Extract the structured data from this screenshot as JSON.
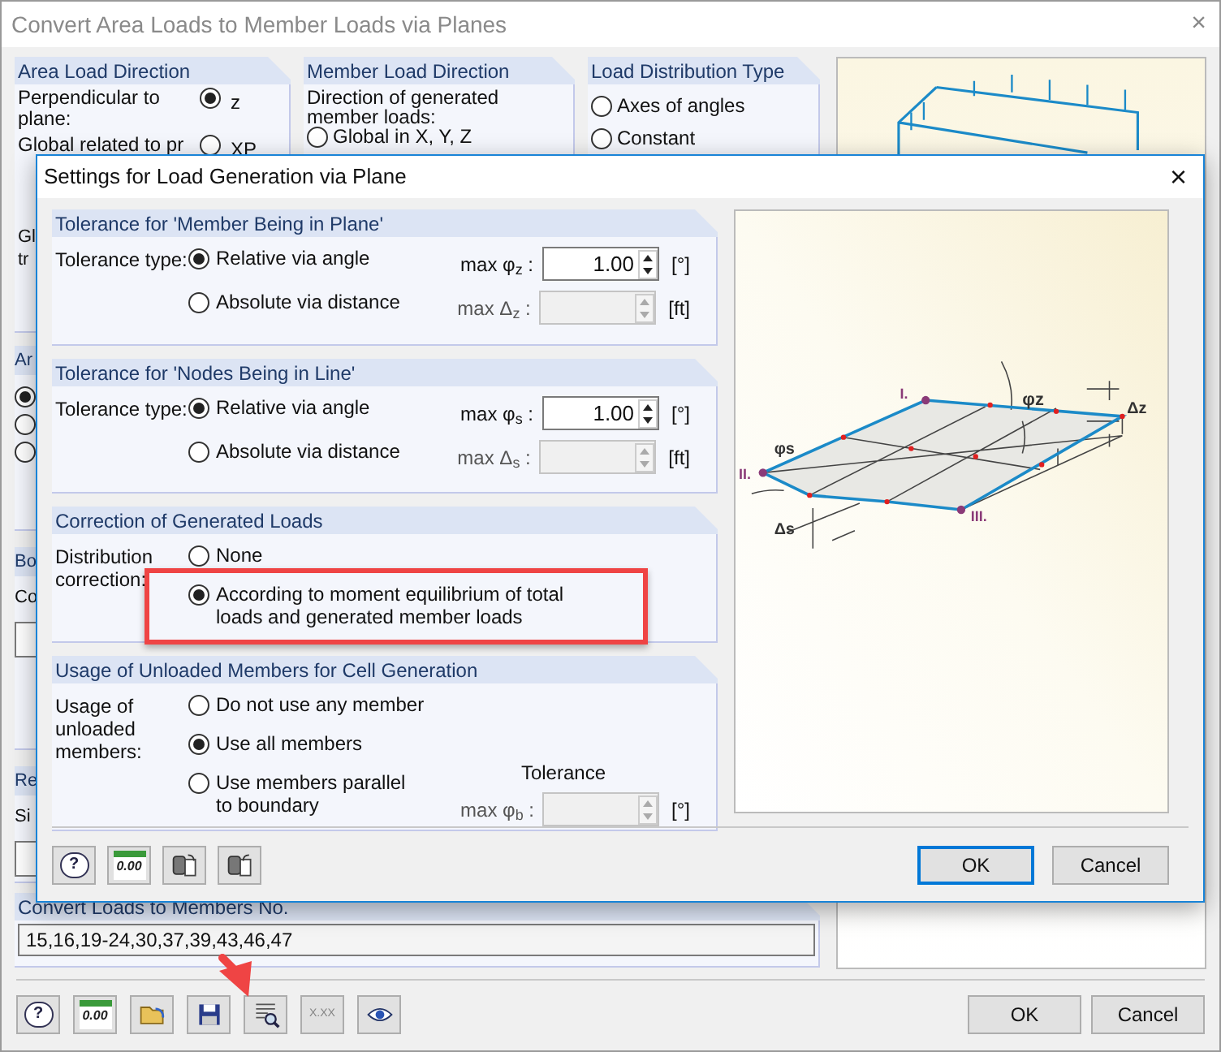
{
  "main_window": {
    "title": "Convert Area Loads to Member Loads via Planes",
    "close": "×",
    "top_groups": [
      {
        "title": "Area Load Direction",
        "rows": [
          {
            "label": "Perpendicular to plane:",
            "option": "z",
            "selected": true
          },
          {
            "label": "Global related to pr",
            "option": "XP",
            "selected": false
          }
        ],
        "fragments": [
          "Gl",
          "tr"
        ]
      },
      {
        "title": "Member Load Direction",
        "text": "Direction of generated member loads:",
        "options": [
          {
            "label": "Global in X, Y, Z",
            "selected": false
          }
        ]
      },
      {
        "title": "Load Distribution Type",
        "options": [
          {
            "label": "Axes of angles",
            "selected": false
          },
          {
            "label": "Constant",
            "selected": false
          }
        ]
      }
    ],
    "left_groups": [
      {
        "title": "Ar",
        "kind": "radios",
        "radios": [
          {
            "selected": true
          },
          {
            "selected": false
          },
          {
            "selected": false
          }
        ]
      },
      {
        "title": "Bo",
        "kind": "field",
        "text": "Co"
      },
      {
        "title": "Re",
        "kind": "field",
        "text": "Si"
      }
    ],
    "members": {
      "title": "Convert Loads to Members No.",
      "value": "15,16,19-24,30,37,39,43,46,47"
    },
    "toolbar": [
      {
        "kind": "help",
        "label": "?"
      },
      {
        "kind": "decimals",
        "label": "0.00"
      },
      {
        "kind": "open"
      },
      {
        "kind": "save"
      },
      {
        "kind": "find"
      },
      {
        "kind": "format",
        "label": "X.XX"
      },
      {
        "kind": "view"
      }
    ],
    "buttons": [
      {
        "label": "OK"
      },
      {
        "label": "Cancel"
      }
    ]
  },
  "dialog": {
    "title": "Settings for Load Generation via Plane",
    "close": "×",
    "groups": [
      {
        "title": "Tolerance for 'Member Being in Plane'",
        "label": "Tolerance type:",
        "options": [
          {
            "label": "Relative via angle",
            "selected": true,
            "field": {
              "label": "max φ$_{z}$ :",
              "value": "1.00",
              "unit": "[°]",
              "disabled": false
            }
          },
          {
            "label": "Absolute via distance",
            "selected": false,
            "field": {
              "label": "max Δ$_{z}$ :",
              "unit": "[ft]",
              "disabled": true
            }
          }
        ]
      },
      {
        "title": "Tolerance for 'Nodes Being in Line'",
        "label": "Tolerance type:",
        "options": [
          {
            "label": "Relative via angle",
            "selected": true,
            "field": {
              "label": "max φ$_{s}$ :",
              "value": "1.00",
              "unit": "[°]",
              "disabled": false
            }
          },
          {
            "label": "Absolute via distance",
            "selected": false,
            "field": {
              "label": "max Δ$_{s}$ :",
              "unit": "[ft]",
              "disabled": true
            }
          }
        ]
      },
      {
        "title": "Correction of Generated Loads",
        "label": "Distribution correction:",
        "options": [
          {
            "label": "None",
            "selected": false
          },
          {
            "label": "According to moment equilibrium of total loads and generated member loads",
            "selected": true,
            "highlighted": true
          }
        ]
      },
      {
        "title": "Usage of Unloaded Members for Cell Generation",
        "label": "Usage of unloaded members:",
        "options": [
          {
            "label": "Do not use any member",
            "selected": false
          },
          {
            "label": "Use all members",
            "selected": true
          },
          {
            "label": "Use members parallel to boundary",
            "selected": false,
            "field": {
              "caption": "Tolerance",
              "label": "max φ$_{b}$ :",
              "unit": "[°]",
              "disabled": true
            }
          }
        ]
      }
    ],
    "diagram_labels": [
      "I.",
      "II.",
      "III.",
      "φz",
      "Δz",
      "φs",
      "Δs"
    ],
    "toolbar": [
      {
        "kind": "help",
        "label": "?"
      },
      {
        "kind": "decimals",
        "label": "0.00"
      },
      {
        "kind": "import"
      },
      {
        "kind": "export"
      }
    ],
    "buttons": [
      {
        "label": "OK",
        "default": true
      },
      {
        "label": "Cancel",
        "default": false
      }
    ]
  },
  "annotations": [
    {
      "kind": "arrow"
    }
  ]
}
